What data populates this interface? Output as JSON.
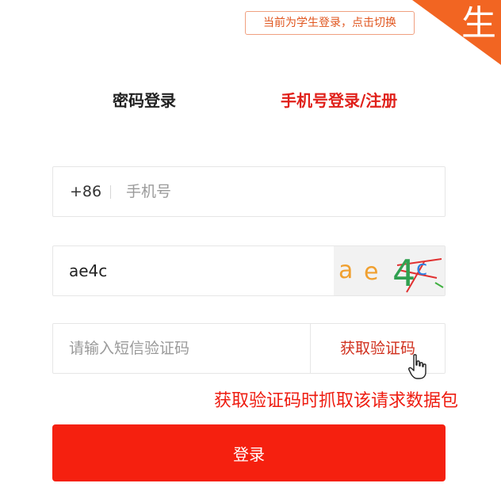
{
  "role_notice": "当前为学生登录，点击切换",
  "corner_badge": "生",
  "tabs": {
    "password": "密码登录",
    "phone": "手机号登录/注册",
    "active": "phone"
  },
  "phone_row": {
    "country_code": "+86",
    "placeholder": "手机号"
  },
  "captcha_row": {
    "value": "ae4c",
    "image_text": "ae4c"
  },
  "sms_row": {
    "placeholder": "请输入短信验证码",
    "button_label": "获取验证码"
  },
  "annotation": "获取验证码时抓取该请求数据包",
  "login_button": "登录",
  "colors": {
    "accent": "#f5200f",
    "tab_active": "#e0201a",
    "notice": "#e0561f",
    "badge": "#f26522",
    "annotation": "#ee1c10"
  },
  "icons": {
    "cursor": "hand-pointer-icon"
  }
}
